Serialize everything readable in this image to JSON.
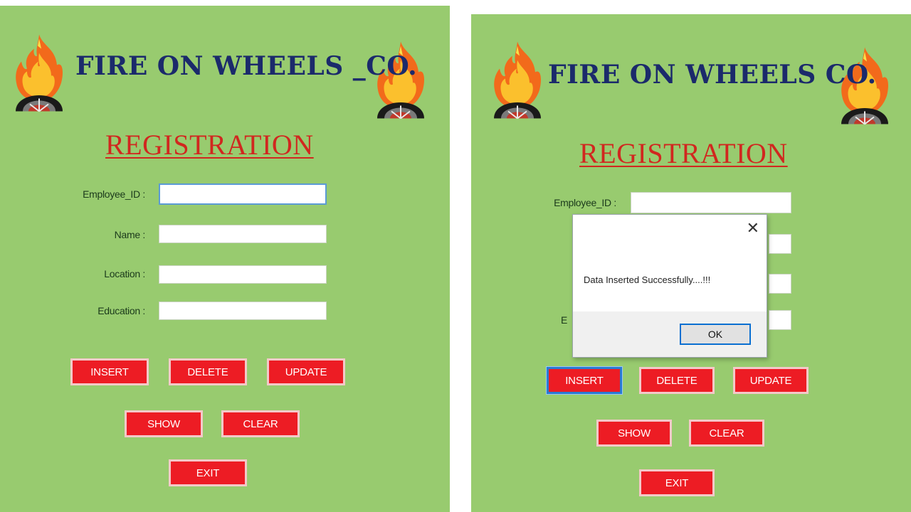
{
  "company_title": "FIRE ON WHEELS _CO.",
  "company_title_right": "FIRE ON WHEELS  CO.",
  "heading": "REGISTRATION",
  "labels": {
    "employee_id": "Employee_ID :",
    "name": "Name :",
    "location": "Location :",
    "education": "Education :",
    "education_partial": "E"
  },
  "fields": {
    "employee_id": "",
    "name": "",
    "location": "",
    "education": ""
  },
  "buttons": {
    "insert": "INSERT",
    "delete": "DELETE",
    "update": "UPDATE",
    "show": "SHOW",
    "clear": "CLEAR",
    "exit": "EXIT"
  },
  "dialog": {
    "message": "Data Inserted Successfully....!!!",
    "ok": "OK",
    "close": "✕"
  },
  "colors": {
    "background": "#98cb6f",
    "title": "#1b2a6b",
    "heading": "#d1271f",
    "button": "#ed1c24"
  },
  "icons": {
    "logo": "flaming-wheel-icon"
  }
}
